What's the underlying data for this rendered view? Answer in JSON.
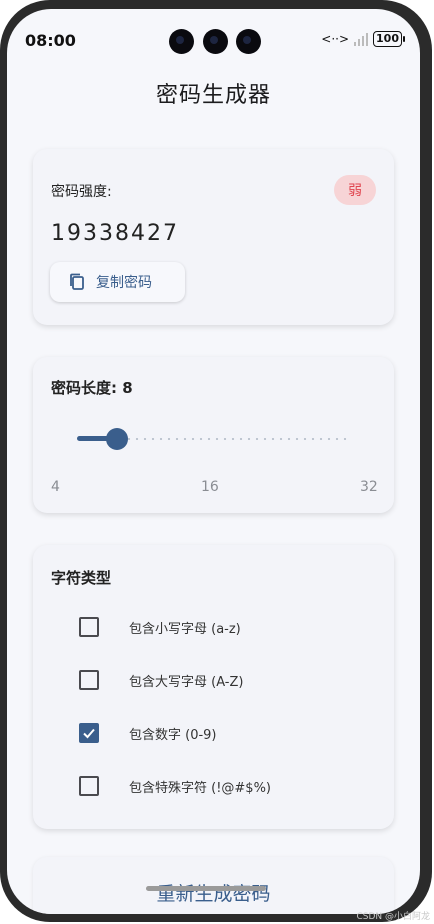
{
  "status_bar": {
    "time": "08:00",
    "battery": "100"
  },
  "page": {
    "title": "密码生成器"
  },
  "password_card": {
    "strength_label": "密码强度:",
    "strength_badge": "弱",
    "password": "19338427",
    "copy_label": "复制密码"
  },
  "length_card": {
    "title": "密码长度: 8",
    "value": 8,
    "min_label": "4",
    "mid_label": "16",
    "max_label": "32"
  },
  "chartype_card": {
    "title": "字符类型",
    "options": [
      {
        "label": "包含小写字母 (a-z)",
        "checked": false
      },
      {
        "label": "包含大写字母 (A-Z)",
        "checked": false
      },
      {
        "label": "包含数字 (0-9)",
        "checked": true
      },
      {
        "label": "包含特殊字符 (!@#$%)",
        "checked": false
      }
    ]
  },
  "regenerate": {
    "label": "重新生成密码"
  },
  "watermark": "CSDN @小白阿龙",
  "colors": {
    "accent": "#3a5e8c",
    "badge_bg": "#f7d4d6",
    "badge_text": "#e0454f",
    "background": "#f6f7fb"
  }
}
